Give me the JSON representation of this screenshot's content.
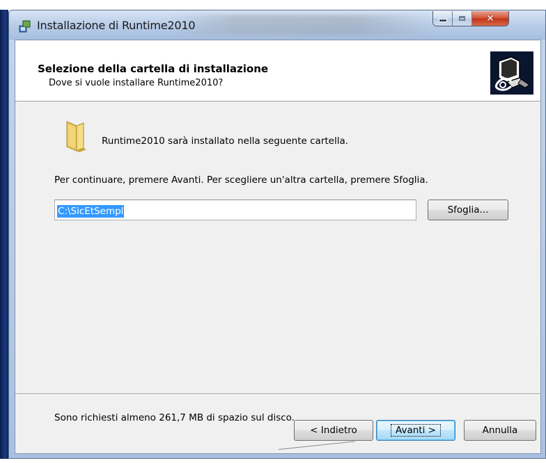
{
  "window": {
    "title": "Installazione di Runtime2010",
    "caption_buttons": {
      "minimize": "minimize-icon",
      "maximize": "maximize-icon",
      "close": "close-icon"
    },
    "close_color": "#c2351b"
  },
  "header": {
    "title": "Selezione della cartella di installazione",
    "subtitle": "Dove si vuole installare Runtime2010?",
    "image": "install-computer-icon"
  },
  "content": {
    "folder_icon": "folder-icon",
    "info": "Runtime2010 sarà installato nella seguente cartella.",
    "instruction": "Per continuare, premere Avanti. Per scegliere un'altra cartella, premere Sfoglia.",
    "path_value": "C:\\SicEtSempl",
    "browse_label": "Sfoglia...",
    "space_required": "Sono richiesti almeno 261,7 MB di spazio sul disco.",
    "selection_color": "#3399ff"
  },
  "footer": {
    "back_label": "< Indietro",
    "next_label": "Avanti >",
    "cancel_label": "Annulla"
  }
}
